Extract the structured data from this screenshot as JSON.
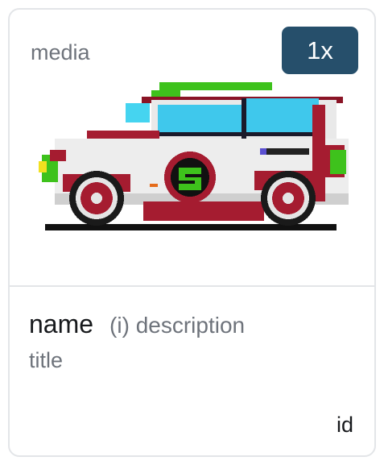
{
  "card": {
    "media_label": "media",
    "zoom_badge": "1x",
    "image": {
      "subject": "pixel-art race car",
      "icon": "car-sprite"
    },
    "name": "name",
    "description": "(i) description",
    "title": "title",
    "id": "id"
  },
  "colors": {
    "badge_bg": "#264f6b",
    "border": "#e3e5e8",
    "muted_text": "#6e737b",
    "car_red": "#a51c30",
    "car_green": "#3ec21c",
    "car_cyan": "#45d4f0"
  }
}
